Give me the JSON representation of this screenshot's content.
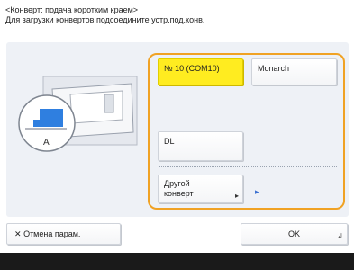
{
  "header": {
    "line1": "<Конверт: подача коротким краем>",
    "line2": "Для загрузки конвертов подсоедините устр.под.конв."
  },
  "options": {
    "no10": "№ 10 (COM10)",
    "monarch": "Monarch",
    "dl": "DL",
    "other_line1": "Другой",
    "other_line2": "конверт"
  },
  "illustration": {
    "label_a": "A"
  },
  "bottom": {
    "cancel": "Отмена парам.",
    "ok": "OK"
  },
  "colors": {
    "selected": "#ffec20",
    "frame": "#f0a224",
    "accent": "#2f7fe0"
  }
}
